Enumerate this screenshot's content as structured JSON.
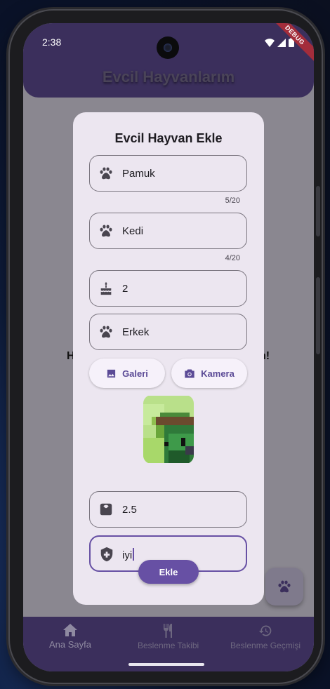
{
  "status": {
    "time": "2:38",
    "debug_label": "DEBUG"
  },
  "app": {
    "title": "Evcil Hayvanlarım"
  },
  "background": {
    "left_char": "H",
    "right_char": "n!"
  },
  "dialog": {
    "title": "Evcil Hayvan Ekle",
    "name": {
      "value": "Pamuk",
      "counter": "5/20",
      "icon": "paw-icon"
    },
    "type": {
      "value": "Kedi",
      "counter": "4/20",
      "icon": "paw-icon"
    },
    "age": {
      "value": "2",
      "icon": "cake-icon"
    },
    "gender": {
      "value": "Erkek",
      "icon": "paw-icon"
    },
    "gallery_button": "Galeri",
    "camera_button": "Kamera",
    "weight": {
      "value": "2.5",
      "icon": "scale-icon"
    },
    "health": {
      "value": "iyi",
      "icon": "health-shield-icon"
    },
    "submit_button": "Ekle"
  },
  "bottom_nav": [
    {
      "label": "Ana Sayfa",
      "icon": "home-icon",
      "active": true
    },
    {
      "label": "Beslenme Takibi",
      "icon": "restaurant-icon",
      "active": false
    },
    {
      "label": "Beslenme Geçmişi",
      "icon": "history-icon",
      "active": false
    }
  ],
  "colors": {
    "primary": "#6750a4",
    "appbar": "#3b2f5c",
    "dialog": "#ece6f0"
  }
}
